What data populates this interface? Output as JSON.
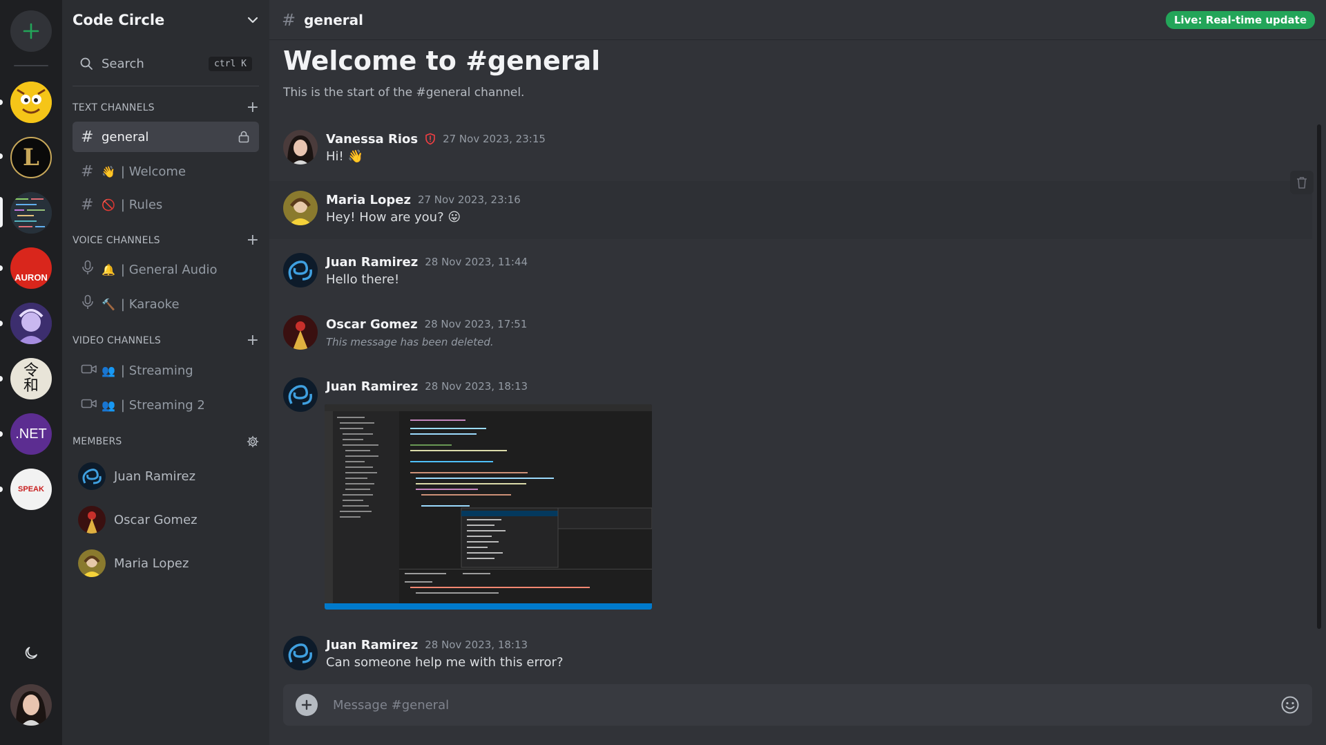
{
  "guild": {
    "name": "Code Circle"
  },
  "search": {
    "label": "Search",
    "shortcut": "ctrl K"
  },
  "sections": {
    "text": "TEXT CHANNELS",
    "voice": "VOICE CHANNELS",
    "video": "VIDEO CHANNELS",
    "members": "MEMBERS"
  },
  "text_channels": [
    {
      "label": "general",
      "emoji": "",
      "active": true
    },
    {
      "label": "| Welcome",
      "emoji": "👋"
    },
    {
      "label": "| Rules",
      "emoji": "🚫"
    }
  ],
  "voice_channels": [
    {
      "label": "| General Audio",
      "emoji": "🔔"
    },
    {
      "label": "| Karaoke",
      "emoji": "🔨"
    }
  ],
  "video_channels": [
    {
      "label": "| Streaming",
      "emoji": "👥"
    },
    {
      "label": "| Streaming 2",
      "emoji": "👥"
    }
  ],
  "members": [
    {
      "name": "Juan Ramirez"
    },
    {
      "name": "Oscar Gomez"
    },
    {
      "name": "Maria Lopez"
    }
  ],
  "servers": [
    {
      "name": "server-1",
      "color": "#f5c518",
      "text": ""
    },
    {
      "name": "server-2",
      "color": "#0a0a0a",
      "text": "L"
    },
    {
      "name": "server-3",
      "color": "#3a4a5a",
      "text": ""
    },
    {
      "name": "server-4",
      "color": "#d9261c",
      "text": "AURON"
    },
    {
      "name": "server-5",
      "color": "#7a5cc0",
      "text": ""
    },
    {
      "name": "server-6",
      "color": "#e8e4d8",
      "text": "令和"
    },
    {
      "name": "server-7",
      "color": "#5c2d91",
      "text": ".NET"
    },
    {
      "name": "server-8",
      "color": "#f2f2f2",
      "text": "SPEAK"
    }
  ],
  "channel": {
    "title": "general",
    "live_badge": "Live: Real-time update"
  },
  "welcome": {
    "title": "Welcome to #general",
    "subtitle": "This is the start of the #general channel."
  },
  "messages": [
    {
      "author": "Vanessa Rios",
      "time": "27 Nov 2023, 23:15",
      "text": "Hi! 👋",
      "shield": true
    },
    {
      "author": "Maria Lopez",
      "time": "27 Nov 2023, 23:16",
      "text": "Hey! How are you? 😛"
    },
    {
      "author": "Juan Ramirez",
      "time": "28 Nov 2023, 11:44",
      "text": "Hello there!"
    },
    {
      "author": "Oscar Gomez",
      "time": "28 Nov 2023, 17:51",
      "text": "This message has been deleted.",
      "deleted": true
    },
    {
      "author": "Juan Ramirez",
      "time": "28 Nov 2023, 18:13",
      "text": "",
      "attachment": "code-screenshot"
    },
    {
      "author": "Juan Ramirez",
      "time": "28 Nov 2023, 18:13",
      "text": "Can someone help me with this error?"
    }
  ],
  "composer": {
    "placeholder": "Message #general"
  },
  "colors": {
    "accent_green": "#23a559",
    "rail_bg": "#1e1f22",
    "sidebar_bg": "#2b2d31",
    "main_bg": "#313338"
  },
  "icons": {
    "add_server": "plus-icon",
    "search": "search-icon",
    "lock": "lock-icon",
    "mic": "microphone-icon",
    "camera": "video-camera-icon",
    "gear": "gear-icon",
    "moon": "moon-icon",
    "trash": "trash-icon",
    "emoji": "smiley-icon"
  }
}
